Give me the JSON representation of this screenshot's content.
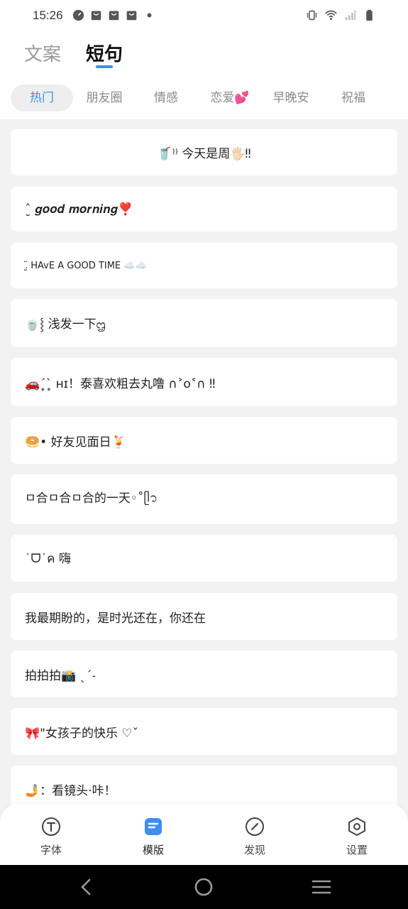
{
  "status_bar": {
    "time": "15:26",
    "left_icons": [
      "speedometer-icon",
      "bag-icon",
      "bag-icon",
      "bag-icon",
      "dot-icon"
    ],
    "right_icons": [
      "vibrate-icon",
      "wifi-icon",
      "signal-icon",
      "battery-icon"
    ]
  },
  "main_tabs": [
    {
      "label": "文案",
      "active": false
    },
    {
      "label": "短句",
      "active": true
    }
  ],
  "categories": [
    {
      "label": "热门",
      "active": true
    },
    {
      "label": "朋友圈",
      "active": false
    },
    {
      "label": "情感",
      "active": false
    },
    {
      "label": "恋爱💕",
      "active": false
    },
    {
      "label": "早晚安",
      "active": false
    },
    {
      "label": "祝福",
      "active": false
    }
  ],
  "items": [
    "🥤⁾⁾ 今天是周🖐🏻‼",
    "ˆ̮ 𝒈𝒐𝒐𝒅 𝒎𝒐𝒓𝒏𝒊𝒏𝒈❣️",
    ".̮̈ HAvE A GOOD TIME ☁️☁️",
    "🍵⸾  浅发一下ᦗ",
    "🚗ˊ̥ˋ̥ ʜɪ！泰喜欢粗去丸噜 ∩˃o˂∩ ‼",
    "🥯• 好友见面日🍹",
    "ㅁ合ㅁ合ㅁ合的一天◦˚ᥫ᭡",
    "˙ᗜ˙ค 嗨",
    "我最期盼的，是时光还在，你还在",
    "拍拍拍📸 ˎˊ˗",
    "🎀\"女孩子的快乐 ♡ˇ",
    "🤳：看镜头·咔！"
  ],
  "bottom_nav": [
    {
      "label": "字体",
      "icon": "font-t-icon",
      "active": false
    },
    {
      "label": "模版",
      "icon": "template-icon",
      "active": true
    },
    {
      "label": "发现",
      "icon": "compass-icon",
      "active": false
    },
    {
      "label": "设置",
      "icon": "hexagon-settings-icon",
      "active": false
    }
  ],
  "colors": {
    "accent": "#3d8ef0",
    "background": "#f2f2f2",
    "card": "#ffffff",
    "inactive_text": "#9a9a9a"
  }
}
